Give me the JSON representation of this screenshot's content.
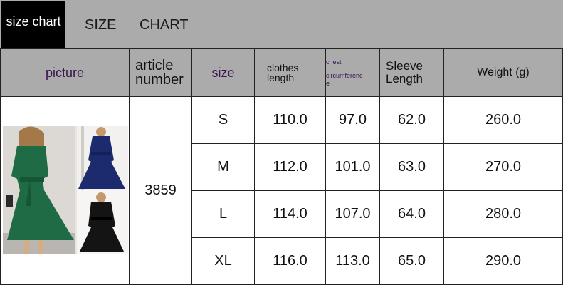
{
  "banner": {
    "tag": "size chart",
    "word1": "SIZE",
    "word2": "CHART"
  },
  "headers": {
    "picture": "picture",
    "article_line1": "article",
    "article_line2": "number",
    "size": "size",
    "clothes_line1": "clothes",
    "clothes_line2": "length",
    "chest_line1": "chest",
    "chest_line2": "circumferenc",
    "chest_line3": "e",
    "sleeve_line1": "Sleeve",
    "sleeve_line2": "Length",
    "weight": "Weight (g)"
  },
  "article_number": "3859",
  "rows": [
    {
      "size": "S",
      "length": "110.0",
      "chest": "97.0",
      "sleeve": "62.0",
      "weight": "260.0"
    },
    {
      "size": "M",
      "length": "112.0",
      "chest": "101.0",
      "sleeve": "63.0",
      "weight": "270.0"
    },
    {
      "size": "L",
      "length": "114.0",
      "chest": "107.0",
      "sleeve": "64.0",
      "weight": "280.0"
    },
    {
      "size": "XL",
      "length": "116.0",
      "chest": "113.0",
      "sleeve": "65.0",
      "weight": "290.0"
    }
  ],
  "colors": {
    "header_bg": "#ababab",
    "header_accent": "#3a1650",
    "dress_green": "#1f6b45",
    "dress_navy": "#1c2a6e",
    "dress_black": "#141414"
  }
}
